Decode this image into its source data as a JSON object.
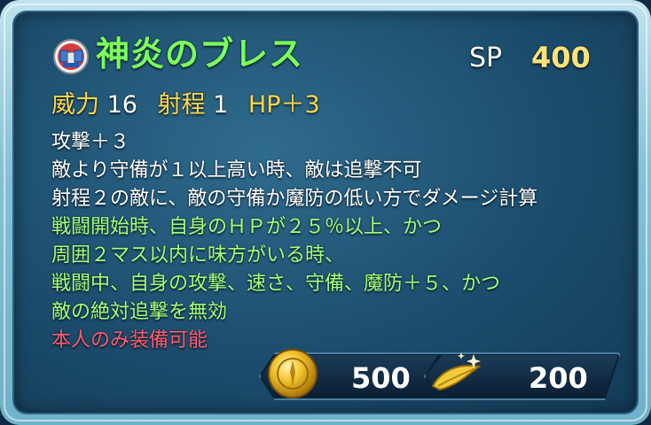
{
  "skill": {
    "name": "神炎のブレス",
    "icon": "weapon-skill-icon",
    "sp_label": "SP",
    "sp_value": "400"
  },
  "stats": {
    "might_label": "威力",
    "might_value": "16",
    "range_label": "射程",
    "range_value": "1",
    "hp_bonus": "HP＋3"
  },
  "description": {
    "line1": "攻撃＋３",
    "line2": "敵より守備が１以上高い時、敵は追撃不可",
    "line3": "射程２の敵に、敵の守備か魔防の低い方でダメージ計算",
    "refine1": "戦闘開始時、自身のＨＰが２５％以上、かつ",
    "refine2": "周囲２マス以内に味方がいる時、",
    "refine3": "戦闘中、自身の攻撃、速さ、守備、魔防＋５、かつ",
    "refine4": "敵の絶対追撃を無効",
    "restriction": "本人のみ装備可能"
  },
  "costs": {
    "arena_medal_icon": "gold-coin-icon",
    "arena_medal_value": "500",
    "dew_icon": "divine-dew-icon",
    "dew_value": "200"
  },
  "colors": {
    "skill_name": "#7cff5a",
    "gold_text": "#ffd84a",
    "refine_text": "#a4ff7c",
    "restriction_text": "#ff5a74"
  }
}
